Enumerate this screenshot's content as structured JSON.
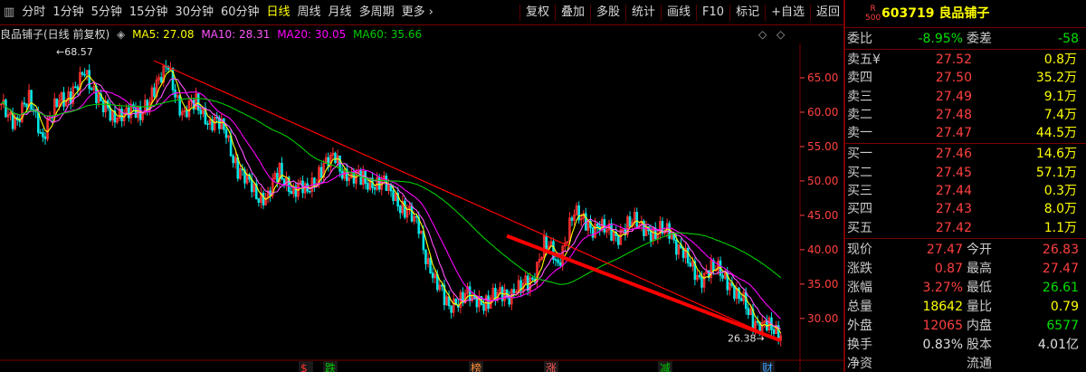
{
  "toolbar": {
    "tabs": [
      {
        "label": "分时",
        "sel": false
      },
      {
        "label": "1分钟",
        "sel": false
      },
      {
        "label": "5分钟",
        "sel": false
      },
      {
        "label": "15分钟",
        "sel": false
      },
      {
        "label": "30分钟",
        "sel": false
      },
      {
        "label": "60分钟",
        "sel": false
      },
      {
        "label": "日线",
        "sel": true
      },
      {
        "label": "周线",
        "sel": false
      },
      {
        "label": "月线",
        "sel": false
      },
      {
        "label": "多周期",
        "sel": false
      },
      {
        "label": "更多",
        "sel": false
      }
    ],
    "tools": [
      "复权",
      "叠加",
      "多股",
      "统计",
      "画线",
      "F10",
      "标记",
      "+自选",
      "返回"
    ]
  },
  "legend": {
    "title": "良品铺子(日线 前复权)",
    "ma5": "MA5: 27.08",
    "ma10": "MA10: 28.31",
    "ma20": "MA20: 30.05",
    "ma60": "MA60: 35.66"
  },
  "colors": {
    "ma5": "#ffff00",
    "ma10": "#ff55ff",
    "ma20": "#ff00ff",
    "ma60": "#00cc00",
    "up": "#ff3030",
    "down": "#00e5e5",
    "trend": "#ff0000",
    "grid": "#7a0000",
    "axis": "#ff4040"
  },
  "chart_data": {
    "type": "candlestick",
    "ylim": [
      25.5,
      70
    ],
    "y_ticks": [
      "65.00",
      "60.00",
      "55.00",
      "50.00",
      "45.00",
      "40.00",
      "35.00",
      "30.00"
    ],
    "high_label": "68.57",
    "low_label": "26.38",
    "closes": [
      60.5,
      59,
      61.5,
      57,
      61,
      63,
      65,
      62.5,
      58.5,
      61,
      59,
      64,
      66,
      60,
      61,
      59,
      57.5,
      52,
      48.5,
      47.5,
      51,
      49,
      48.5,
      52,
      53,
      50.5,
      50,
      50,
      48.5,
      46,
      43,
      36,
      32,
      33,
      33,
      32.5,
      33.5,
      34,
      35,
      41,
      38,
      45,
      44,
      43,
      42,
      43.5,
      44,
      42,
      43,
      39,
      36,
      37,
      36.5,
      33,
      30,
      28.5,
      27.47
    ],
    "events": [
      "$",
      "跌",
      "榜",
      "涨",
      "减",
      "财"
    ]
  },
  "panel": {
    "r_tag_top": "R",
    "r_tag_bottom": "500",
    "code_name": "603719 良品铺子",
    "webi": {
      "l1": "委比",
      "v1": "-8.95%",
      "l2": "委差",
      "v2": "-58"
    },
    "asks": [
      {
        "l": "卖五",
        "sym": "¥",
        "p": "27.52",
        "v": "0.8万"
      },
      {
        "l": "卖四",
        "sym": "",
        "p": "27.50",
        "v": "35.2万"
      },
      {
        "l": "卖三",
        "sym": "",
        "p": "27.49",
        "v": "9.1万"
      },
      {
        "l": "卖二",
        "sym": "",
        "p": "27.48",
        "v": "7.4万"
      },
      {
        "l": "卖一",
        "sym": "",
        "p": "27.47",
        "v": "44.5万"
      }
    ],
    "bids": [
      {
        "l": "买一",
        "p": "27.46",
        "v": "14.6万"
      },
      {
        "l": "买二",
        "p": "27.45",
        "v": "57.1万"
      },
      {
        "l": "买三",
        "p": "27.44",
        "v": "0.3万"
      },
      {
        "l": "买四",
        "p": "27.43",
        "v": "8.0万"
      },
      {
        "l": "买五",
        "p": "27.42",
        "v": "1.1万"
      }
    ],
    "stats": [
      {
        "l1": "现价",
        "v1": "27.47",
        "c1": "red",
        "l2": "今开",
        "v2": "26.83",
        "c2": "red"
      },
      {
        "l1": "涨跌",
        "v1": "0.87",
        "c1": "red",
        "l2": "最高",
        "v2": "27.47",
        "c2": "red"
      },
      {
        "l1": "涨幅",
        "v1": "3.27%",
        "c1": "red",
        "l2": "最低",
        "v2": "26.61",
        "c2": "grn"
      },
      {
        "l1": "总量",
        "v1": "18642",
        "c1": "yel",
        "l2": "量比",
        "v2": "0.79",
        "c2": "yel"
      },
      {
        "l1": "外盘",
        "v1": "12065",
        "c1": "red",
        "l2": "内盘",
        "v2": "6577",
        "c2": "grn"
      },
      {
        "l1": "换手",
        "v1": "0.83%",
        "c1": "wht",
        "l2": "股本",
        "v2": "4.01亿",
        "c2": "wht"
      },
      {
        "l1": "净资",
        "v1": "",
        "c1": "wht",
        "l2": "流通",
        "v2": "",
        "c2": "wht"
      }
    ]
  }
}
